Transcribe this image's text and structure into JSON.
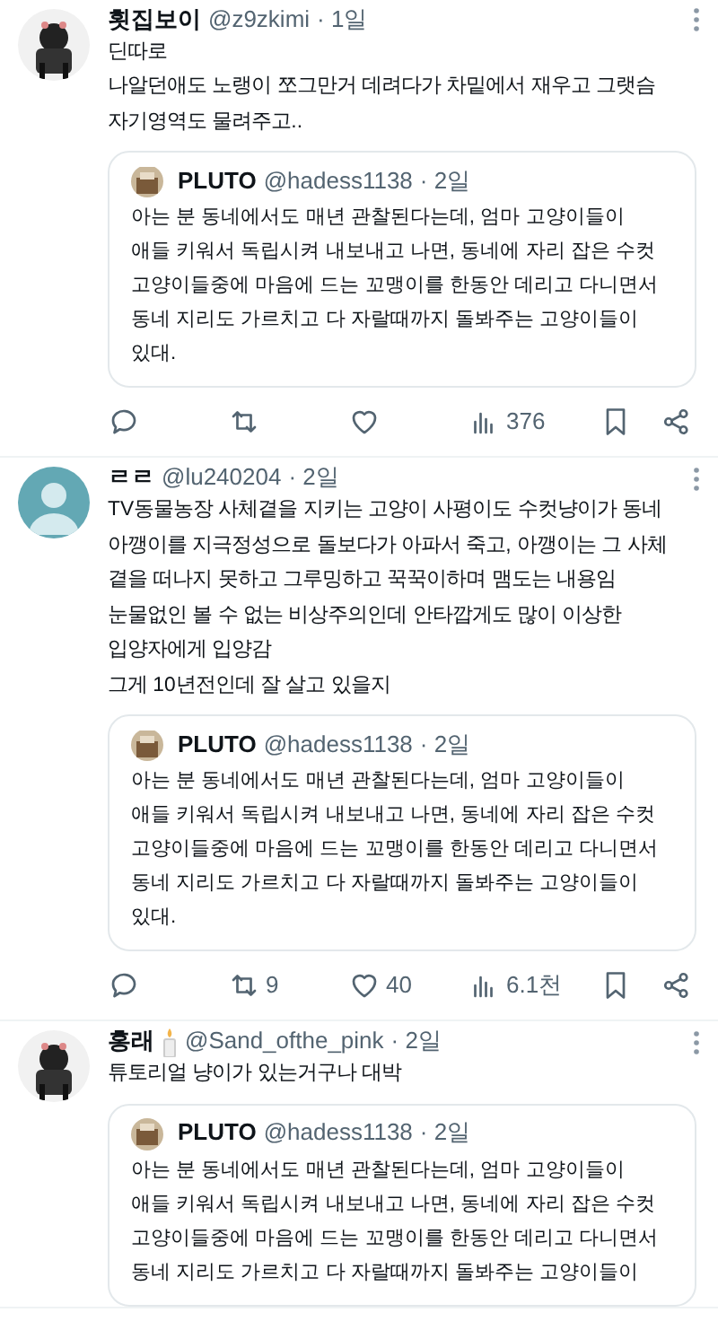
{
  "tweets": [
    {
      "name": "횟집보이",
      "handle": "@z9zkimi",
      "time": "· 1일",
      "name_candle": false,
      "text": "딘따로\n나알던애도 노랭이 쪼그만거 데려다가 차밑에서 재우고 그랫슴\n자기영역도 물려주고..",
      "quote": {
        "name": "PLUTO",
        "handle": "@hadess1138",
        "time": "· 2일",
        "text": "아는 분 동네에서도 매년 관찰된다는데, 엄마 고양이들이\n애들 키워서 독립시켜 내보내고 나면, 동네에 자리 잡은 수컷\n고양이들중에 마음에 드는 꼬맹이를 한동안 데리고 다니면서\n동네 지리도 가르치고 다 자랄때까지 돌봐주는 고양이들이\n있대."
      },
      "actions": {
        "views": "376"
      }
    },
    {
      "name": "ㄹㄹ",
      "handle": "@lu240204",
      "time": "· 2일",
      "avatar": {
        "kind": "default"
      },
      "name_candle": false,
      "text": "TV동물농장 사체곁을 지키는 고양이 사평이도 수컷냥이가 동네\n아깽이를 지극정성으로 돌보다가 아파서 죽고, 아깽이는 그 사체\n곁을 떠나지 못하고 그루밍하고 꾹꾹이하며 맴도는 내용임\n눈물없인 볼 수 없는 비상주의인데 안타깝게도 많이 이상한\n입양자에게 입양감\n그게 10년전인데 잘 살고 있을지",
      "quote": {
        "name": "PLUTO",
        "handle": "@hadess1138",
        "time": "· 2일",
        "text": "아는 분 동네에서도 매년 관찰된다는데, 엄마 고양이들이\n애들 키워서 독립시켜 내보내고 나면, 동네에 자리 잡은 수컷\n고양이들중에 마음에 드는 꼬맹이를 한동안 데리고 다니면서\n동네 지리도 가르치고 다 자랄때까지 돌봐주는 고양이들이\n있대."
      },
      "actions": {
        "retweet": "9",
        "like": "40",
        "views": "6.1천"
      }
    },
    {
      "name": "홍래",
      "handle": "@Sand_ofthe_pink",
      "time": "· 2일",
      "name_candle": true,
      "text": "튜토리얼 냥이가 있는거구나 대박",
      "quote": {
        "name": "PLUTO",
        "handle": "@hadess1138",
        "time": "· 2일",
        "text": "아는 분 동네에서도 매년 관찰된다는데, 엄마 고양이들이\n애들 키워서 독립시켜 내보내고 나면, 동네에 자리 잡은 수컷\n고양이들중에 마음에 드는 꼬맹이를 한동안 데리고 다니면서\n동네 지리도 가르치고 다 자랄때까지 돌봐주는 고양이들이"
      }
    }
  ]
}
